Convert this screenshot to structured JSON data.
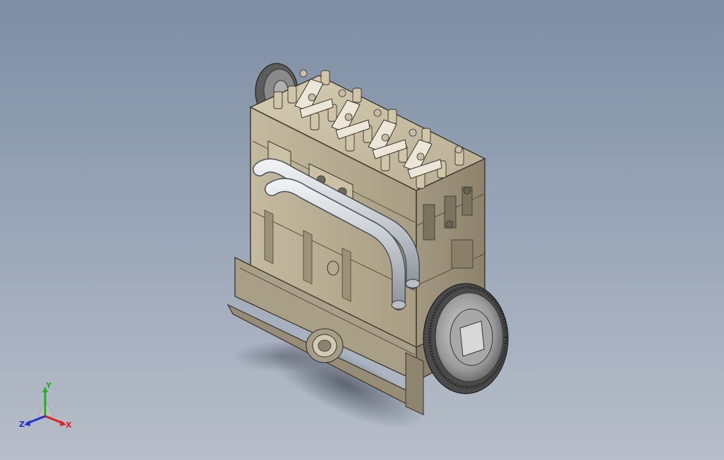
{
  "viewport": {
    "background_top": "#7e8ea5",
    "background_bottom": "#b7bec9",
    "model": {
      "kind": "engine-block-assembly",
      "body_color": "#b5ab92",
      "shade_color": "#8f8570",
      "pipe_color": "#cfd3d8",
      "flywheel_color": "#9d9d9d"
    }
  },
  "triad": {
    "x_label": "X",
    "y_label": "Y",
    "z_label": "Z",
    "x_color": "#e02020",
    "y_color": "#20b020",
    "z_color": "#2030d0"
  }
}
